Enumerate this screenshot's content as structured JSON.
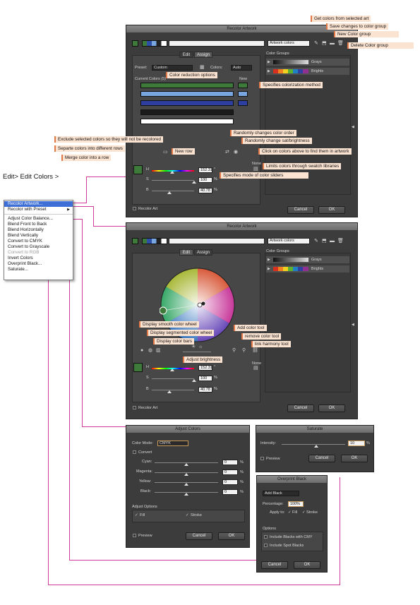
{
  "callouts": {
    "get_colors": "Get colors from selected art",
    "save_changes": "Save changes to color group",
    "new_group": "New Color group",
    "delete_group": "Delete Color group",
    "reduction": "Color reduction options",
    "colorization": "Specifies colorization method",
    "random_order": "Randomly changes color order",
    "random_sat": "Randomly change sat/brightness",
    "exclude": "Exclude selected colors so they will not be recolored",
    "separate": "Separte colors into different rows",
    "new_row": "New row",
    "click_find": "Click on colors above to find them in artwork",
    "merge": "Merge color into a row",
    "swatch_lib": "Limits colors through swatch libraries",
    "slider_mode": "Specifies mode of color sliders",
    "smooth": "Display smooth color wheel",
    "segmented": "Display segmented color wheel",
    "bars": "Display color bars",
    "brightness": "Adjust brightness",
    "add_tool": "Add color tool",
    "remove_tool": "remove color tool",
    "link_tool": "link harmony tool"
  },
  "heading": "Edit> Edit Colors >",
  "menu": {
    "items": [
      "Recolor Artwork...",
      "Recolor with Preset",
      "Adjust Color Balance...",
      "Blend Front to Back",
      "Blend Horizontally",
      "Blend Vertically",
      "Convert to CMYK",
      "Convert to Grayscale",
      "Convert to RGB",
      "Invert Colors",
      "Overprint Black...",
      "Saturate..."
    ],
    "submenu_arrow": "▶"
  },
  "recolor1": {
    "title": "Recolor Artwork",
    "group_name": "Artwork colors",
    "tab_edit": "Edit",
    "tab_assign": "Assign",
    "preset_label": "Preset:",
    "preset_value": "Custom",
    "colors_label": "Colors:",
    "colors_value": "Auto",
    "current_colors": "Current Colors (5)",
    "new_label": "New",
    "color_groups": "Color Groups",
    "groups": [
      "Grays",
      "Brights"
    ],
    "h_label": "H",
    "s_label": "S",
    "b_label": "B",
    "h_value": "152.31",
    "s_value": "100",
    "b_value": "40.78",
    "deg": "°",
    "pct": "%",
    "none_label": "None",
    "recolor_art": "Recolor Art",
    "cancel": "Cancel",
    "ok": "OK",
    "accent": "#3e7a3a"
  },
  "recolor2": {
    "title": "Recolor Artwork",
    "group_name": "Artwork colors",
    "tab_edit": "Edit",
    "tab_assign": "Assign",
    "color_groups": "Color Groups",
    "groups": [
      "Grays",
      "Brights"
    ],
    "h_label": "H",
    "s_label": "S",
    "b_label": "B",
    "h_value": "152.31",
    "s_value": "100",
    "b_value": "40.78",
    "deg": "°",
    "pct": "%",
    "none_label": "None",
    "recolor_art": "Recolor Art",
    "cancel": "Cancel",
    "ok": "OK"
  },
  "adjust": {
    "title": "Adjust Colors",
    "mode_label": "Color Mode:",
    "mode_value": "CMYK",
    "convert": "Convert",
    "channels": [
      {
        "label": "Cyan:",
        "value": "0"
      },
      {
        "label": "Magenta:",
        "value": "0"
      },
      {
        "label": "Yellow:",
        "value": "0"
      },
      {
        "label": "Black:",
        "value": "0"
      }
    ],
    "pct": "%",
    "options_label": "Adjust Options",
    "fill": "Fill",
    "stroke": "Stroke",
    "preview": "Preview",
    "cancel": "Cancel",
    "ok": "OK"
  },
  "saturate": {
    "title": "Saturate",
    "intensity_label": "Intensity:",
    "intensity_value": "10",
    "pct": "%",
    "preview": "Preview",
    "cancel": "Cancel",
    "ok": "OK"
  },
  "overprint": {
    "title": "Overprint Black",
    "mode_value": "Add Black",
    "percentage_label": "Percentage:",
    "percentage_value": "100%",
    "apply_label": "Apply to:",
    "fill": "Fill",
    "stroke": "Stroke",
    "options_label": "Options",
    "opt1": "Include Blacks with CMY",
    "opt2": "Include Spot Blacks",
    "cancel": "Cancel",
    "ok": "OK"
  }
}
